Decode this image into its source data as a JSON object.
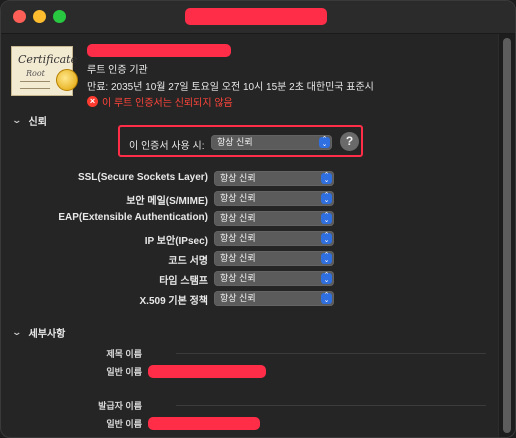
{
  "header": {
    "kind": "루트 인증 기관",
    "expiry": "만료: 2035년 10월 27일 토요일 오전 10시 15분 2초 대한민국 표준시",
    "warning": "이 루트 인증서는 신뢰되지 않음",
    "cert_icon_text": "Certificate",
    "cert_icon_sub": "Root"
  },
  "trust": {
    "section_title": "신뢰",
    "use_label": "이 인증서 사용 시:",
    "use_value": "항상 신뢰",
    "help": "?",
    "policies": [
      {
        "label": "SSL(Secure Sockets Layer)",
        "value": "항상 신뢰"
      },
      {
        "label": "보안 메일(S/MIME)",
        "value": "항상 신뢰"
      },
      {
        "label": "EAP(Extensible Authentication)",
        "value": "항상 신뢰"
      },
      {
        "label": "IP 보안(IPsec)",
        "value": "항상 신뢰"
      },
      {
        "label": "코드 서명",
        "value": "항상 신뢰"
      },
      {
        "label": "타임 스탬프",
        "value": "항상 신뢰"
      },
      {
        "label": "X.509 기본 정책",
        "value": "항상 신뢰"
      }
    ]
  },
  "details": {
    "section_title": "세부사항",
    "subject_title": "제목 이름",
    "subject_common_name_label": "일반 이름",
    "issuer_title": "발급자 이름",
    "issuer_common_name_label": "일반 이름"
  },
  "colors": {
    "warning": "#ff453a",
    "redaction": "#ff2d48",
    "popup_arrow": "#2f6fe0"
  }
}
